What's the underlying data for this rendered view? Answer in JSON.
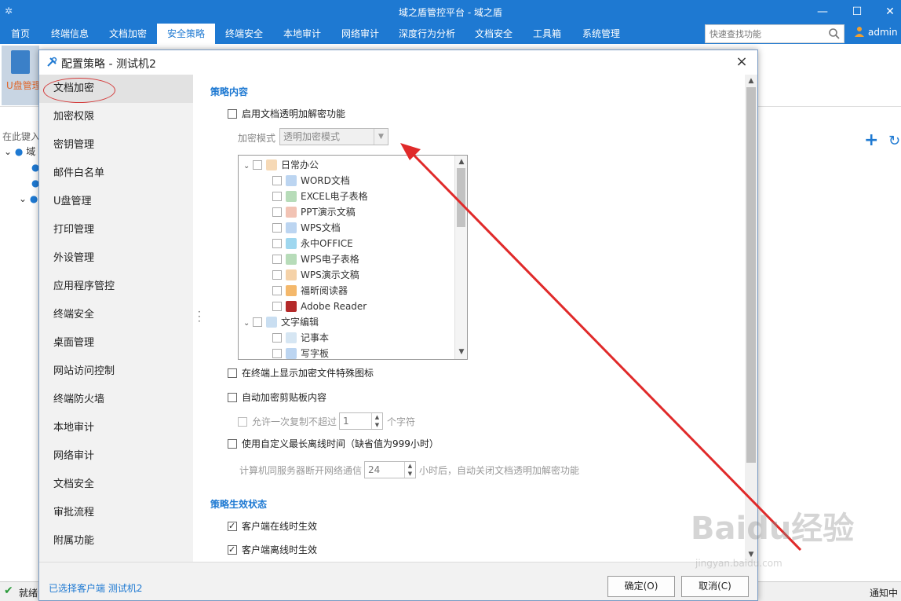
{
  "app": {
    "title": "域之盾管控平台 - 域之盾",
    "minimize": "—",
    "maximize": "☐",
    "close": "✕"
  },
  "menu": {
    "items": [
      "首页",
      "终端信息",
      "文档加密",
      "安全策略",
      "终端安全",
      "本地审计",
      "网络审计",
      "深度行为分析",
      "文档安全",
      "工具箱",
      "系统管理"
    ],
    "active_index": 3,
    "search_placeholder": "快速查找功能",
    "user": "admin"
  },
  "toolbar": {
    "udisk_label": "U盘管理"
  },
  "background": {
    "filter_hint": "在此键入",
    "tree": [
      "域",
      "",
      ""
    ]
  },
  "status": {
    "left": "就绪",
    "right": "通知中"
  },
  "dialog": {
    "title": "配置策略 - 测试机2",
    "close": "×",
    "nav": [
      "文档加密",
      "加密权限",
      "密钥管理",
      "邮件白名单",
      "U盘管理",
      "打印管理",
      "外设管理",
      "应用程序管控",
      "终端安全",
      "桌面管理",
      "网站访问控制",
      "终端防火墙",
      "本地审计",
      "网络审计",
      "文档安全",
      "审批流程",
      "附属功能"
    ],
    "active_nav": 0,
    "content": {
      "section1_title": "策略内容",
      "enable_label": "启用文档透明加解密功能",
      "enable_checked": false,
      "mode_label": "加密模式",
      "mode_value": "透明加密模式",
      "tree": {
        "group1": "日常办公",
        "group1_items": [
          "WORD文档",
          "EXCEL电子表格",
          "PPT演示文稿",
          "WPS文档",
          "永中OFFICE",
          "WPS电子表格",
          "WPS演示文稿",
          "福昕阅读器",
          "Adobe Reader"
        ],
        "group2": "文字编辑",
        "group2_items": [
          "记事本",
          "写字板"
        ]
      },
      "show_icon_label": "在终端上显示加密文件特殊图标",
      "clipboard_label": "自动加密剪贴板内容",
      "allow_copy_label": "允许一次复制不超过",
      "allow_copy_value": "1",
      "allow_copy_unit": "个字符",
      "offline_label": "使用自定义最长离线时间（缺省值为999小时）",
      "offline_prefix": "计算机同服务器断开网络通信",
      "offline_value": "24",
      "offline_suffix": "小时后，自动关闭文档透明加解密功能",
      "section2_title": "策略生效状态",
      "online_label": "客户端在线时生效",
      "offline_effect_label": "客户端离线时生效"
    },
    "footer": {
      "selected": "已选择客户端 测试机2",
      "ok": "确定(O)",
      "cancel": "取消(C)"
    }
  },
  "watermark": {
    "brand": "Baidu经验",
    "url": "jingyan.baidu.com"
  },
  "colors": {
    "accent": "#1e79d2",
    "annotation": "#e02a2a"
  }
}
